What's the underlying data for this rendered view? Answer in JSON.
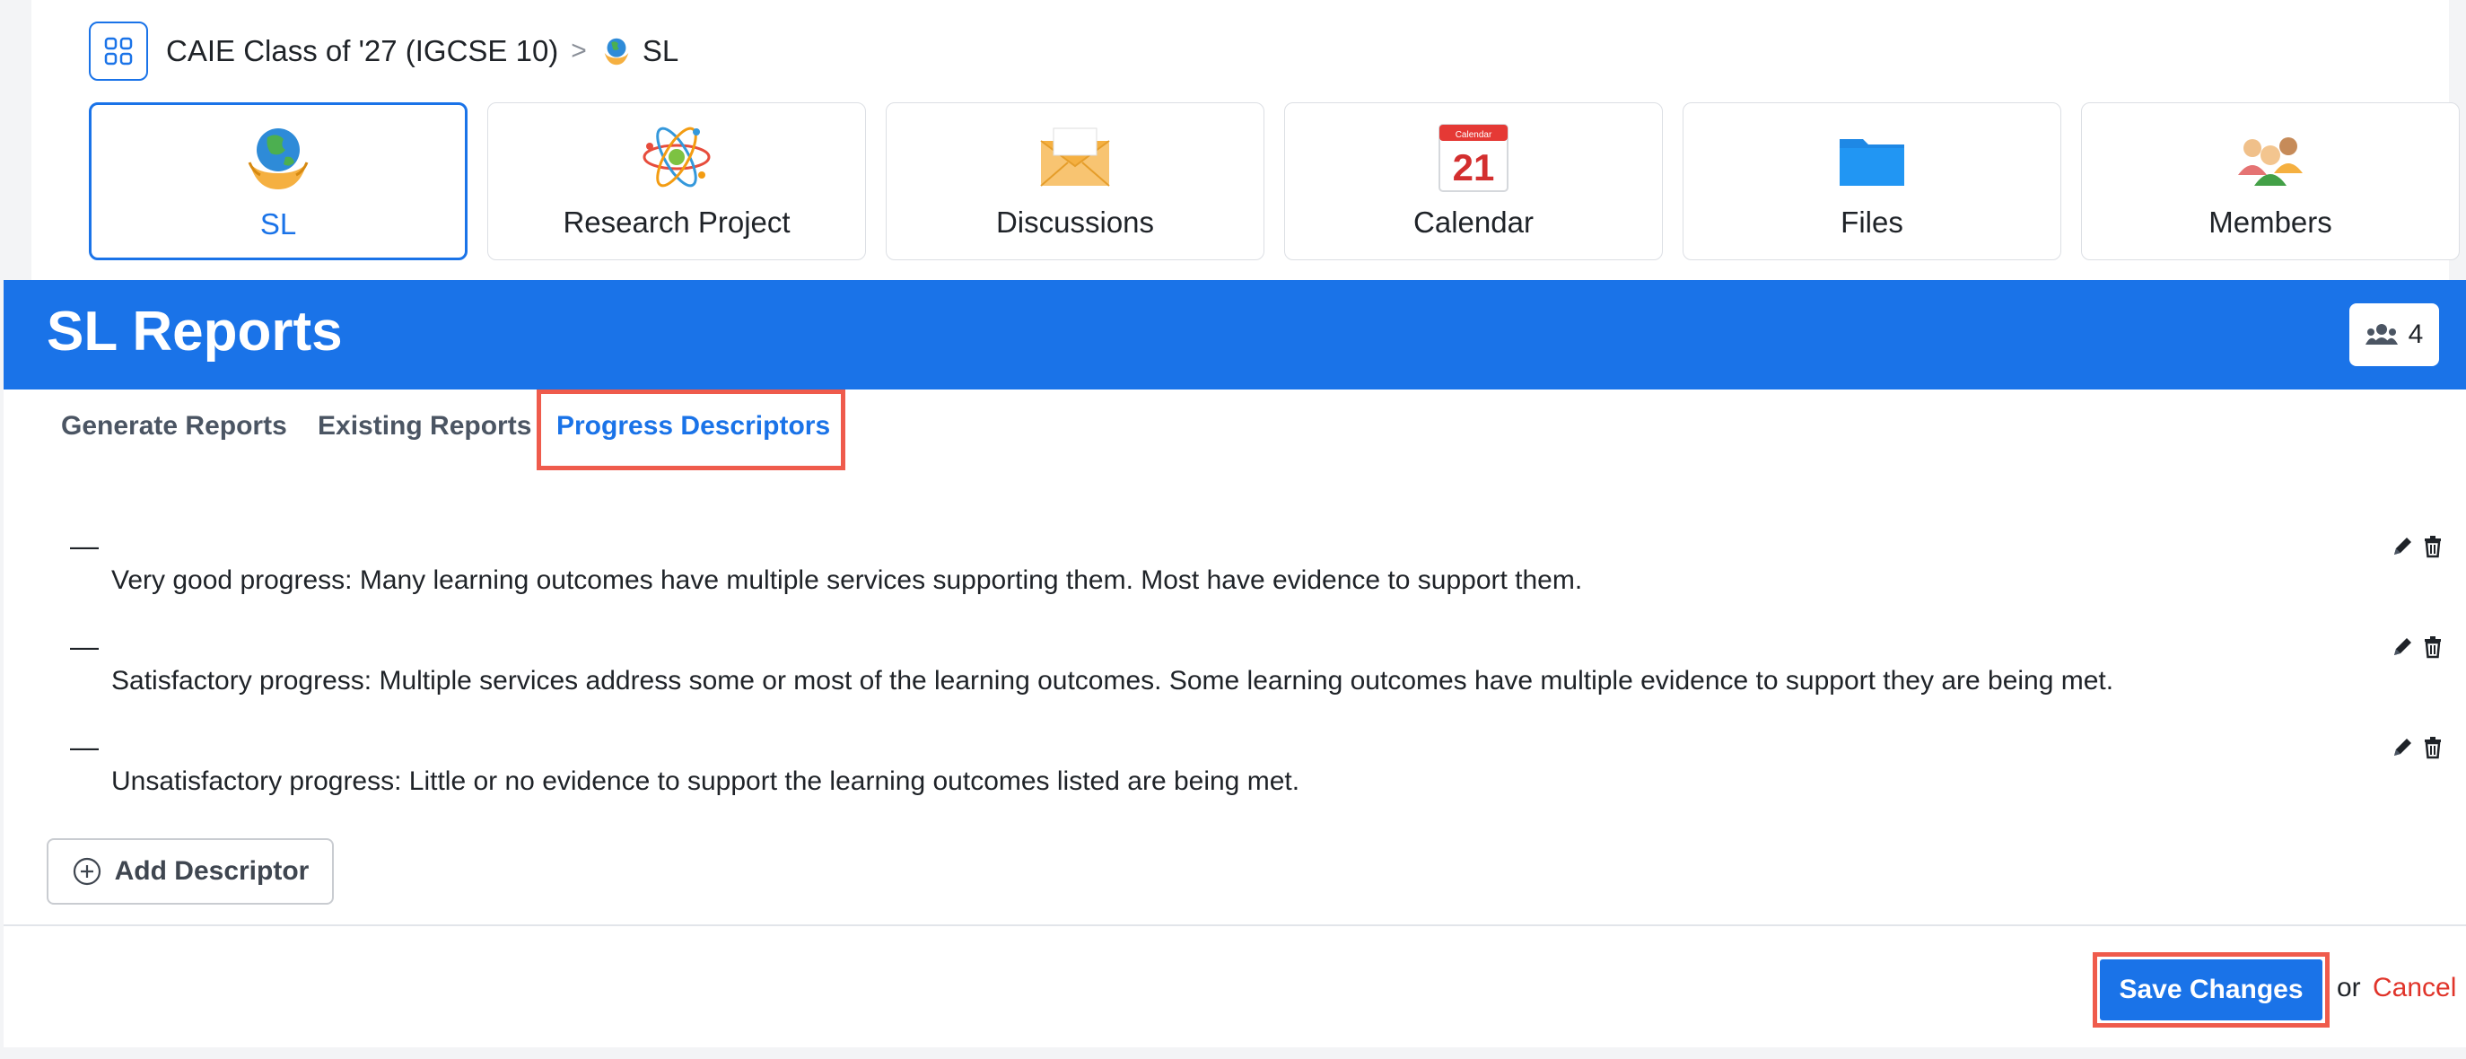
{
  "breadcrumb": {
    "class_name": "CAIE Class of '27 (IGCSE 10)",
    "separator": ">",
    "current": "SL"
  },
  "tiles": [
    {
      "label": "SL",
      "icon": "globe-hands-icon",
      "active": true
    },
    {
      "label": "Research Project",
      "icon": "atom-icon",
      "active": false
    },
    {
      "label": "Discussions",
      "icon": "envelope-icon",
      "active": false
    },
    {
      "label": "Calendar",
      "icon": "calendar-icon",
      "active": false,
      "calendar_day": "21",
      "calendar_header": "Calendar"
    },
    {
      "label": "Files",
      "icon": "folder-icon",
      "active": false
    },
    {
      "label": "Members",
      "icon": "people-icon",
      "active": false
    }
  ],
  "panel": {
    "title": "SL Reports",
    "members_count": "4"
  },
  "tabs": [
    {
      "label": "Generate Reports",
      "active": false
    },
    {
      "label": "Existing Reports",
      "active": false
    },
    {
      "label": "Progress Descriptors",
      "active": true
    }
  ],
  "descriptors": [
    {
      "dash": "—",
      "text": "Very good progress: Many learning outcomes have multiple services supporting them. Most have evidence to support them."
    },
    {
      "dash": "—",
      "text": "Satisfactory progress: Multiple services address some or most of the learning outcomes. Some learning outcomes have multiple evidence to support they are being met."
    },
    {
      "dash": "—",
      "text": "Unsatisfactory progress: Little or no evidence to support the learning outcomes listed are being met."
    }
  ],
  "actions": {
    "add_descriptor": "Add Descriptor",
    "save": "Save Changes",
    "or": "or",
    "cancel": "Cancel"
  },
  "colors": {
    "accent": "#1a73e8",
    "highlight": "#ef5b4c",
    "cancel": "#e0342a"
  }
}
